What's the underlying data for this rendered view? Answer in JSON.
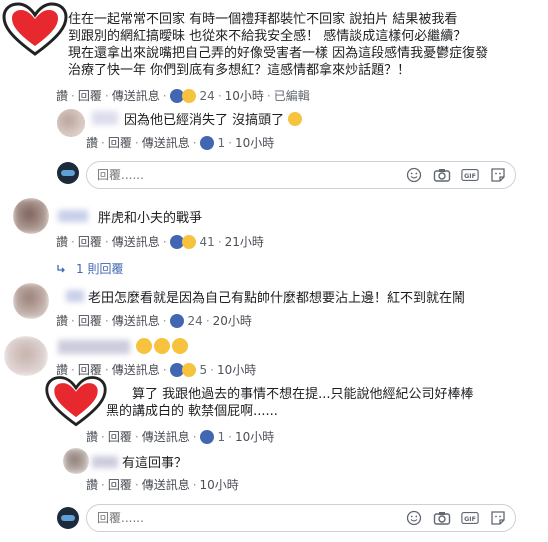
{
  "comments": [
    {
      "text_lines": [
        "住在一起常常不回家 有時一個禮拜都裝忙不回家 說拍片 結果被我看",
        "到跟別的網紅搞曖昧 也從來不給我安全感！ 感情談成這樣何必繼續？",
        "現在還拿出來說嘴把自己弄的好像受害者一樣 因為這段感情我憂鬱症復發",
        "治療了快一年 你們到底有多想紅？這感情都拿來炒話題？！"
      ],
      "actions": {
        "like": "讚",
        "reply": "回覆",
        "message": "傳送訊息",
        "count": "24",
        "time": "10小時",
        "edited": "已編輯"
      }
    },
    {
      "text": "因為他已經消失了 沒搞頭了",
      "actions": {
        "like": "讚",
        "reply": "回覆",
        "message": "傳送訊息",
        "count": "1",
        "time": "10小時"
      }
    },
    {
      "text": "胖虎和小夫的戰爭",
      "actions": {
        "like": "讚",
        "reply": "回覆",
        "message": "傳送訊息",
        "count": "41",
        "time": "21小時"
      }
    },
    {
      "text": "老田怎麼看就是因為自己有點帥什麼都想要沾上邊！紅不到就在鬧",
      "actions": {
        "like": "讚",
        "reply": "回覆",
        "message": "傳送訊息",
        "count": "24",
        "time": "20小時"
      }
    },
    {
      "actions": {
        "like": "讚",
        "reply": "回覆",
        "message": "傳送訊息",
        "count": "5",
        "time": "10小時"
      }
    },
    {
      "text_lines": [
        "算了 我跟他過去的事情不想在提...只能說他經紀公司好棒棒",
        "黑的講成白的 軟禁個屁啊......"
      ],
      "actions": {
        "like": "讚",
        "reply": "回覆",
        "message": "傳送訊息",
        "count": "1",
        "time": "10小時"
      }
    },
    {
      "text": "有這回事？",
      "actions": {
        "like": "讚",
        "reply": "回覆",
        "message": "傳送訊息",
        "time": "10小時"
      }
    }
  ],
  "reply_toggle": "1 則回覆",
  "reply_placeholder": "回覆......",
  "colors": {
    "link": "#4267b2",
    "heart": "#e8282f",
    "action": "#606770"
  }
}
